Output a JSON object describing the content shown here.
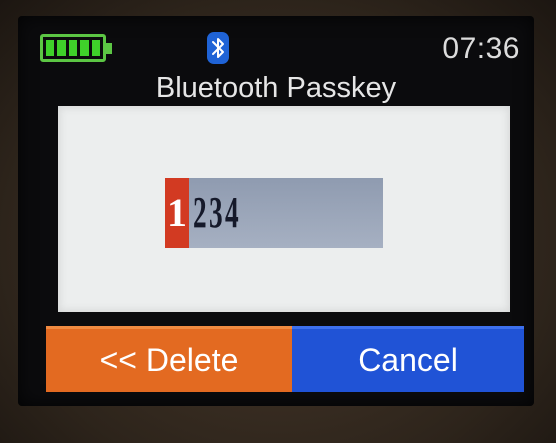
{
  "status_bar": {
    "battery_icon": "battery-full-icon",
    "battery_level": 1.0,
    "bluetooth_icon": "bluetooth-icon",
    "time": "07:36"
  },
  "screen": {
    "title": "Bluetooth Passkey"
  },
  "passkey": {
    "digits": [
      "1",
      "2",
      "3",
      "4"
    ],
    "active_index": 0,
    "active_color": "#d23a22"
  },
  "buttons": {
    "delete_label": "<< Delete",
    "delete_color": "#e36a21",
    "cancel_label": "Cancel",
    "cancel_color": "#2053d6"
  }
}
